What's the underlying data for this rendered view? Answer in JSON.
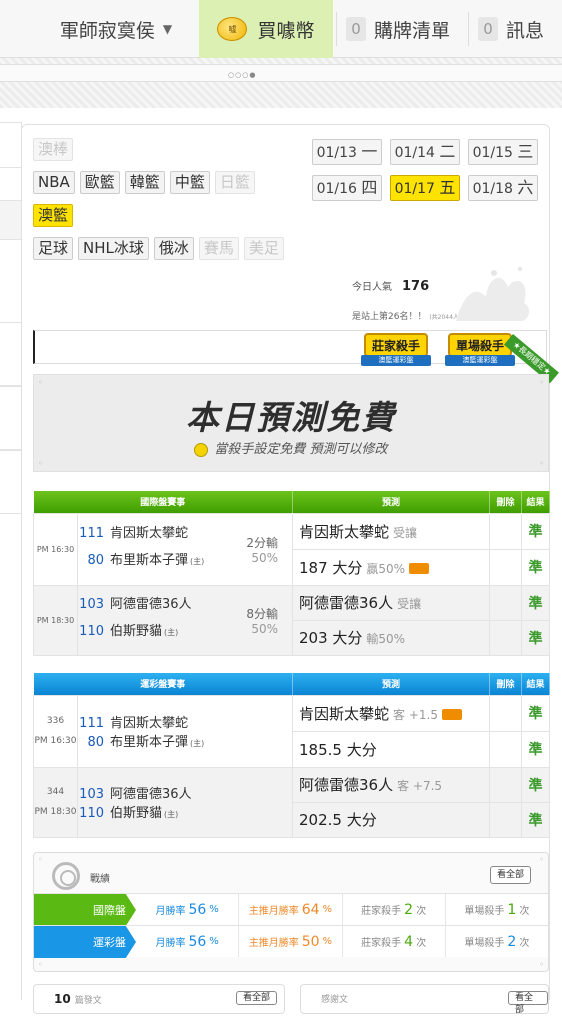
{
  "nav": {
    "user": "軍師寂寞侯",
    "coin": "買噱幣",
    "coin_icon_text": "噓",
    "cart_count": "0",
    "cart": "購牌清單",
    "msg_count": "0",
    "messages": "訊息"
  },
  "sports": {
    "row1": [
      "澳棒"
    ],
    "row2": [
      "NBA",
      "歐籃",
      "韓籃",
      "中籃",
      "日籃"
    ],
    "row3": [
      "澳籃"
    ],
    "row4": [
      "足球",
      "NHL冰球",
      "俄冰",
      "賽馬",
      "美足"
    ]
  },
  "dates": [
    {
      "md": "01/13",
      "dw": "一"
    },
    {
      "md": "01/14",
      "dw": "二"
    },
    {
      "md": "01/15",
      "dw": "三"
    },
    {
      "md": "01/16",
      "dw": "四"
    },
    {
      "md": "01/17",
      "dw": "五"
    },
    {
      "md": "01/18",
      "dw": "六"
    }
  ],
  "popularity": {
    "label": "今日人氣",
    "value": "176",
    "rank": "是站上第26名！！",
    "rank_total": "(共2044人)"
  },
  "badges": {
    "banker": "莊家殺手",
    "banker_sub": "澳籃運彩盤",
    "single": "單場殺手",
    "single_sub": "澳籃運彩盤",
    "corner": "★長期穩定★"
  },
  "banner": {
    "title": "本日預測免費",
    "subtitle": "當殺手設定免費 預測可以修改"
  },
  "intl_table": {
    "headers": [
      "國際盤賽事",
      "預測",
      "刪除",
      "結果"
    ],
    "games": [
      {
        "time": "PM 16:30",
        "away_num": "111",
        "away": "肯因斯太攀蛇",
        "home_num": "80",
        "home": "布里斯本子彈",
        "home_mark": "(主)",
        "spread": "2分輸",
        "pct": "50%",
        "pred1": "肯因斯太攀蛇",
        "pred1_sub": "受讓",
        "res1": "準",
        "pred2": "187 大分",
        "pred2_sub": "贏50%",
        "res2": "準"
      },
      {
        "time": "PM 18:30",
        "away_num": "103",
        "away": "阿德雷德36人",
        "home_num": "110",
        "home": "伯斯野貓",
        "home_mark": "(主)",
        "spread": "8分輸",
        "pct": "50%",
        "pred1": "阿德雷德36人",
        "pred1_sub": "受讓",
        "res1": "準",
        "pred2": "203 大分",
        "pred2_sub": "輸50%",
        "res2": "準"
      }
    ]
  },
  "lott_table": {
    "headers": [
      "運彩盤賽事",
      "預測",
      "刪除",
      "結果"
    ],
    "games": [
      {
        "id": "336",
        "time": "PM 16:30",
        "away_num": "111",
        "away": "肯因斯太攀蛇",
        "home_num": "80",
        "home": "布里斯本子彈",
        "home_mark": "(主)",
        "pred1": "肯因斯太攀蛇",
        "pred1_sub": "客 +1.5",
        "res1": "準",
        "pred2": "185.5 大分",
        "res2": "準"
      },
      {
        "id": "344",
        "time": "PM 18:30",
        "away_num": "103",
        "away": "阿德雷德36人",
        "home_num": "110",
        "home": "伯斯野貓",
        "home_mark": "(主)",
        "pred1": "阿德雷德36人",
        "pred1_sub": "客 +7.5",
        "res1": "準",
        "pred2": "202.5 大分",
        "res2": "準"
      }
    ]
  },
  "record": {
    "title": "戰績",
    "view_all": "看全部",
    "rows": [
      {
        "label": "國際盤",
        "color": "#5bb913",
        "monthly_label": "月勝率",
        "monthly": "56",
        "monthly_unit": "%",
        "main_label": "主推月勝率",
        "main": "64",
        "main_unit": "%",
        "banker_label": "莊家殺手",
        "banker": "2",
        "banker_unit": "次",
        "single_label": "單場殺手",
        "single": "1",
        "single_unit": "次"
      },
      {
        "label": "運彩盤",
        "color": "#1a96e6",
        "monthly_label": "月勝率",
        "monthly": "56",
        "monthly_unit": "%",
        "main_label": "主推月勝率",
        "main": "50",
        "main_unit": "%",
        "banker_label": "莊家殺手",
        "banker": "4",
        "banker_unit": "次",
        "single_label": "單場殺手",
        "single": "2",
        "single_unit": "次"
      }
    ]
  },
  "bottom": {
    "left_count": "10",
    "left_label": "篇發文",
    "left_btn": "看全部",
    "right_label": "感謝文",
    "right_btn": "看全部"
  }
}
